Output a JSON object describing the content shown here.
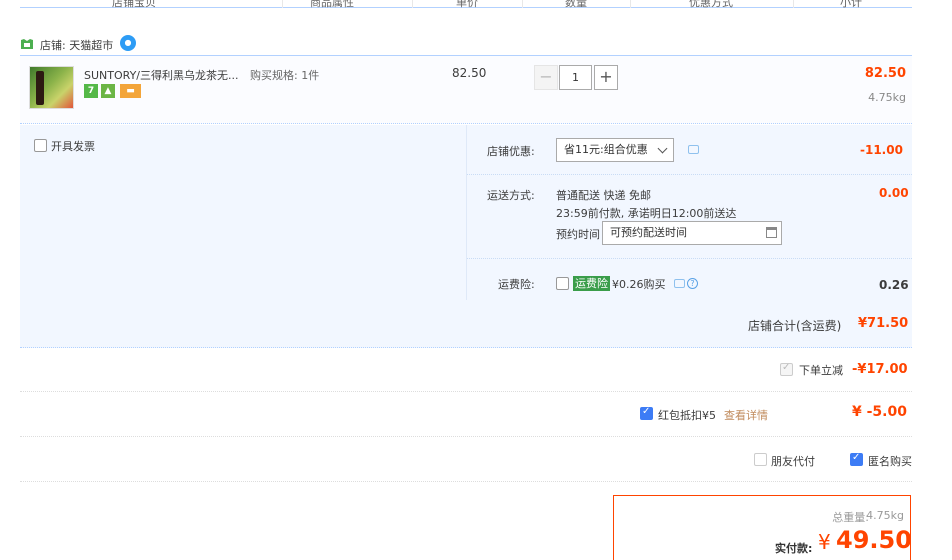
{
  "header": {
    "columns": [
      "店铺宝贝",
      "商品属性",
      "单价",
      "数量",
      "优惠方式",
      "小计"
    ]
  },
  "shop": {
    "name": "店铺: 天猫超市",
    "icon": "tmall-shop-icon"
  },
  "item": {
    "title": "SUNTORY/三得利黑乌龙茶无...",
    "badges": [
      "7",
      "",
      ""
    ],
    "spec": "购买规格: 1件",
    "unit_price": "82.50",
    "quantity": "1",
    "minus": "−",
    "plus": "+",
    "subtotal": "82.50",
    "weight": "4.75kg"
  },
  "invoice": {
    "label": "开具发票"
  },
  "shop_discount": {
    "label": "店铺优惠:",
    "selected": "省11元:组合优惠",
    "value": "-11.00"
  },
  "shipping": {
    "label": "运送方式:",
    "line1": "普通配送 快递 免邮",
    "line2": "23:59前付款, 承诺明日12:00前送达",
    "reserve_label": "预约时间",
    "reserve_value": "可预约配送时间",
    "value": "0.00"
  },
  "insurance": {
    "label": "运费险:",
    "tag": "运费险",
    "text": "¥0.26购买",
    "value": "0.26"
  },
  "shop_total": {
    "label": "店铺合计(含运费)",
    "value": "¥71.50"
  },
  "order_discount": {
    "label": "下单立减",
    "value": "-¥17.00"
  },
  "red_packet": {
    "label": "红包抵扣¥5",
    "link": "查看详情",
    "value": "¥ -5.00"
  },
  "friend_pay": {
    "label": "朋友代付"
  },
  "anonymous": {
    "label": "匿名购买"
  },
  "payment": {
    "weight_label": "总重量:",
    "weight": "4.75kg",
    "pay_label": "实付款:",
    "currency": "¥",
    "value": "49.50"
  },
  "colors": {
    "accent_red": "#ff4400",
    "blue_border": "#b2d1ff",
    "light_blue_bg": "#f2f7ff",
    "checkbox_blue": "#3d7cf5"
  }
}
